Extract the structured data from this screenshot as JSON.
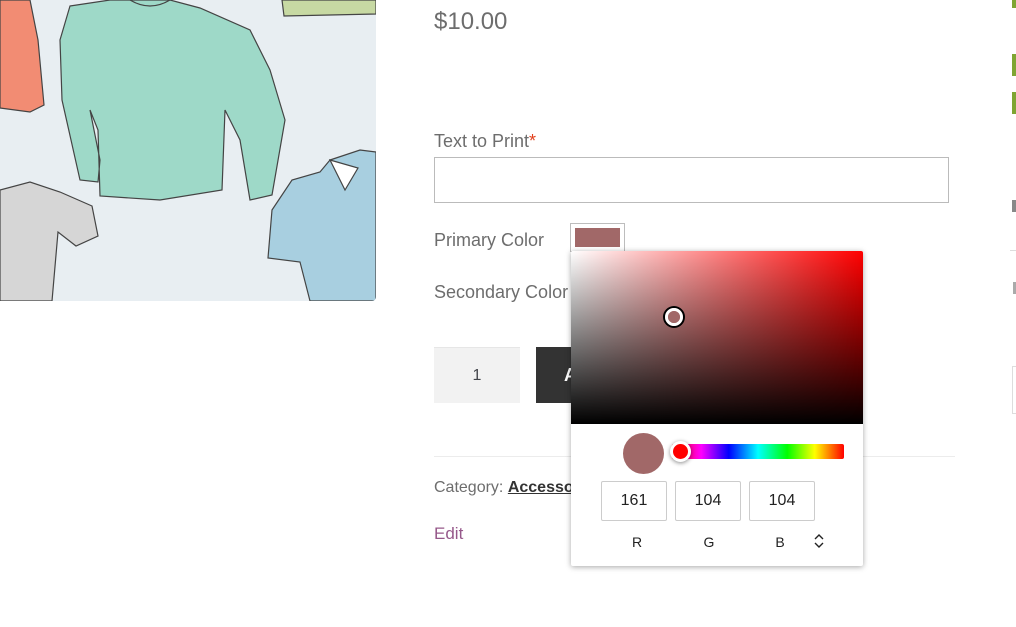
{
  "product": {
    "price": "$10.00",
    "text_to_print_label": "Text to Print",
    "required_mark": "*",
    "text_to_print_value": "",
    "primary_color_label": "Primary Color",
    "secondary_color_label": "Secondary Color",
    "quantity": "1",
    "add_to_cart_label": "A",
    "category_label": "Category:",
    "category_value": "Accessor",
    "edit_label": "Edit"
  },
  "colors": {
    "selected": "#a16868",
    "accent_link": "#96588a",
    "right_link": "#7fa532"
  },
  "color_picker": {
    "hue_value": "#ff0000",
    "r": "161",
    "g": "104",
    "b": "104",
    "r_label": "R",
    "g_label": "G",
    "b_label": "B",
    "mode_toggle_icon": "updown-chevron-icon"
  }
}
